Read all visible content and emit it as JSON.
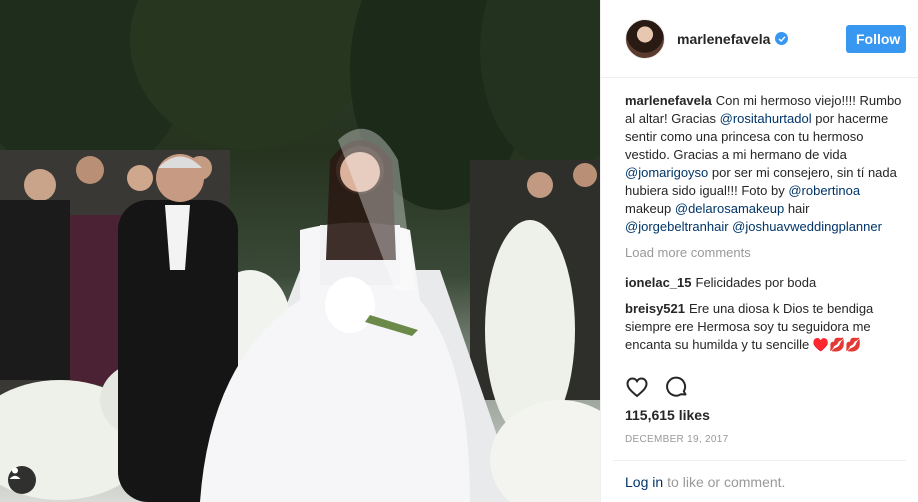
{
  "post": {
    "username": "marlenefavela",
    "follow_label": "Follow",
    "caption_user": "marlenefavela",
    "caption_parts": [
      {
        "t": "text",
        "v": "Con mi hermoso viejo!!!! Rumbo al altar! Gracias "
      },
      {
        "t": "mention",
        "v": "@rositahurtadol"
      },
      {
        "t": "text",
        "v": " por hacerme sentir como una princesa con tu hermoso vestido. Gracias a mi hermano de vida "
      },
      {
        "t": "mention",
        "v": "@jomarigoyso"
      },
      {
        "t": "text",
        "v": " por ser mi consejero, sin tí nada hubiera sido igual!!! Foto by "
      },
      {
        "t": "mention",
        "v": "@robertinoa"
      },
      {
        "t": "text",
        "v": " makeup "
      },
      {
        "t": "mention",
        "v": "@delarosamakeup"
      },
      {
        "t": "text",
        "v": " hair "
      },
      {
        "t": "mention",
        "v": "@jorgebeltranhair"
      },
      {
        "t": "text",
        "v": " "
      },
      {
        "t": "mention",
        "v": "@joshuavweddingplanner"
      }
    ],
    "load_more": "Load more comments",
    "comments": [
      {
        "user": "ionelac_15",
        "text": "Felicidades por boda"
      },
      {
        "user": "breisy521",
        "text": "Ere una diosa k Dios te bendiga siempre ere Hermosa soy tu seguidora me encanta su humilda y tu sencille ♥️💋💋"
      }
    ],
    "likes": "115,615 likes",
    "date": "DECEMBER 19, 2017",
    "login_link": "Log in",
    "login_text": "to like or comment."
  },
  "icons": {
    "verified": "verified-badge-icon",
    "like": "heart-icon",
    "comment": "comment-icon",
    "user_tag": "user-tag-icon"
  },
  "colors": {
    "accent": "#3897f0",
    "link": "#003569",
    "muted": "#999999"
  }
}
